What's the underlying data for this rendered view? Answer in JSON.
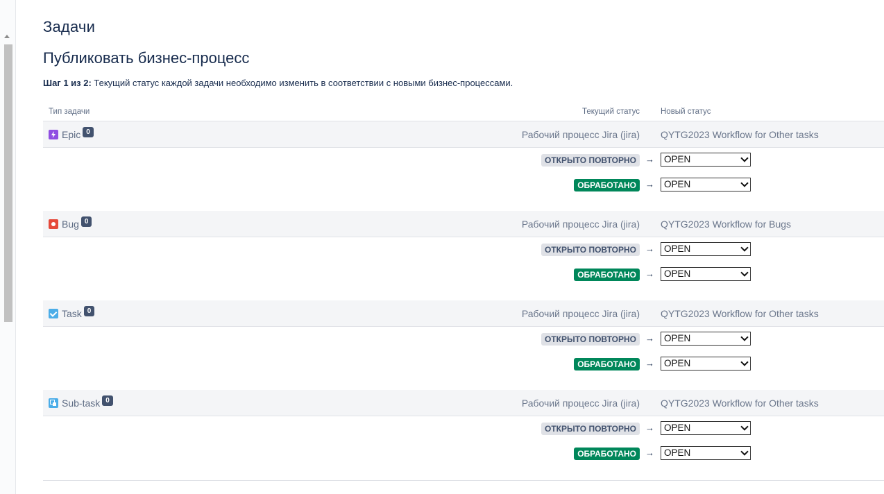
{
  "page": {
    "title": "Задачи",
    "subtitle": "Публиковать бизнес-процесс",
    "step_label": "Шаг 1 из 2:",
    "step_text": " Текущий статус каждой задачи необходимо изменить в соответствии с новыми бизнес-процессами."
  },
  "table": {
    "col_type": "Тип задачи",
    "col_current": "Текущий статус",
    "col_new": "Новый статус"
  },
  "groups": [
    {
      "type": "Epic",
      "icon": "epic-icon",
      "count": "0",
      "current_workflow": "Рабочий процесс Jira (jira)",
      "new_workflow": "QYTG2023 Workflow for Other tasks",
      "mappings": [
        {
          "status": "ОТКРЫТО ПОВТОРНО",
          "target": "OPEN"
        },
        {
          "status": "ОБРАБОТАНО",
          "target": "OPEN"
        }
      ]
    },
    {
      "type": "Bug",
      "icon": "bug-icon",
      "count": "0",
      "current_workflow": "Рабочий процесс Jira (jira)",
      "new_workflow": "QYTG2023 Workflow for Bugs",
      "mappings": [
        {
          "status": "ОТКРЫТО ПОВТОРНО",
          "target": "OPEN"
        },
        {
          "status": "ОБРАБОТАНО",
          "target": "OPEN"
        }
      ]
    },
    {
      "type": "Task",
      "icon": "task-icon",
      "count": "0",
      "current_workflow": "Рабочий процесс Jira (jira)",
      "new_workflow": "QYTG2023 Workflow for Other tasks",
      "mappings": [
        {
          "status": "ОТКРЫТО ПОВТОРНО",
          "target": "OPEN"
        },
        {
          "status": "ОБРАБОТАНО",
          "target": "OPEN"
        }
      ]
    },
    {
      "type": "Sub-task",
      "icon": "subtask-icon",
      "count": "0",
      "current_workflow": "Рабочий процесс Jira (jira)",
      "new_workflow": "QYTG2023 Workflow for Other tasks",
      "mappings": [
        {
          "status": "ОТКРЫТО ПОВТОРНО",
          "target": "OPEN"
        },
        {
          "status": "ОБРАБОТАНО",
          "target": "OPEN"
        }
      ]
    }
  ],
  "arrow": "→",
  "colors": {
    "lozenge_grey": "#dfe1e6",
    "lozenge_green": "#00875a",
    "epic": "#904ee2",
    "bug": "#e5493a",
    "task": "#4bade8"
  }
}
